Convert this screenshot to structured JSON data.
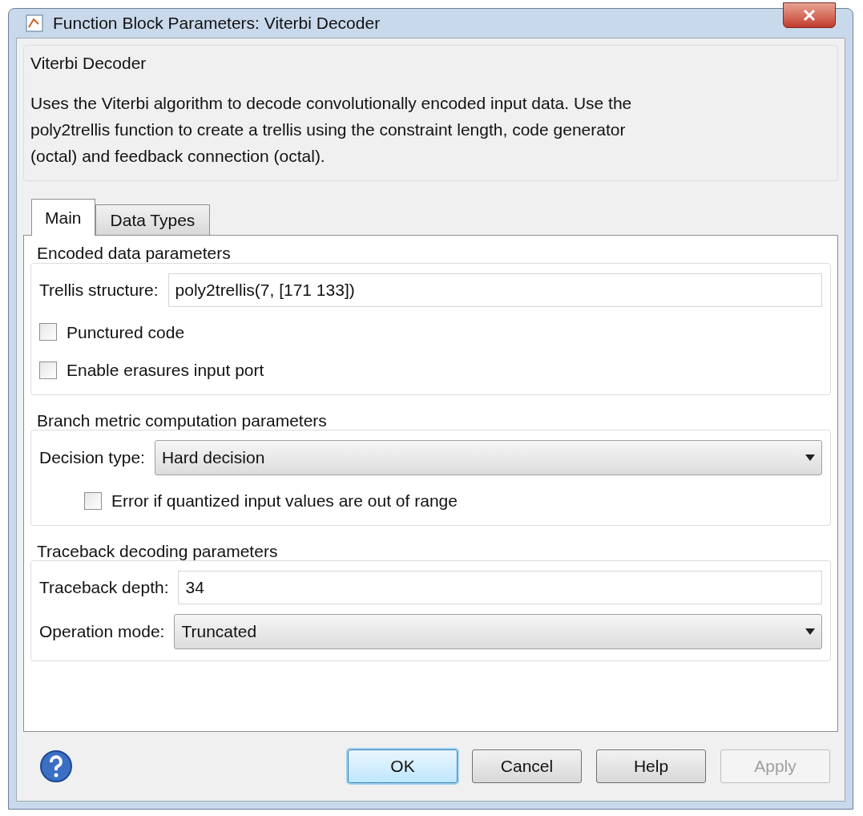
{
  "window": {
    "title": "Function Block Parameters: Viterbi Decoder"
  },
  "description": {
    "title": "Viterbi Decoder",
    "text": "Uses the Viterbi algorithm to decode convolutionally encoded input data.  Use the poly2trellis function to create a trellis using the constraint length, code generator (octal) and feedback connection (octal)."
  },
  "tabs": [
    {
      "label": "Main",
      "selected": true
    },
    {
      "label": "Data Types",
      "selected": false
    }
  ],
  "groups": [
    {
      "title": "Encoded data parameters",
      "items": [
        {
          "kind": "field",
          "label": "Trellis structure:",
          "value": "poly2trellis(7, [171 133])"
        },
        {
          "kind": "checkbox",
          "label": "Punctured code",
          "checked": false
        },
        {
          "kind": "checkbox",
          "label": "Enable erasures input port",
          "checked": false
        }
      ]
    },
    {
      "title": "Branch metric computation parameters",
      "items": [
        {
          "kind": "dropdown",
          "label": "Decision type:",
          "value": "Hard decision"
        },
        {
          "kind": "subcheckbox",
          "label": "Error if quantized input values are out of range",
          "checked": false
        }
      ]
    },
    {
      "title": "Traceback decoding parameters",
      "items": [
        {
          "kind": "field",
          "label": "Traceback depth:",
          "value": "34"
        },
        {
          "kind": "dropdown",
          "label": "Operation mode:",
          "value": "Truncated"
        }
      ]
    }
  ],
  "buttons": [
    {
      "label": "OK",
      "default": true,
      "disabled": false
    },
    {
      "label": "Cancel",
      "default": false,
      "disabled": false
    },
    {
      "label": "Help",
      "default": false,
      "disabled": false
    },
    {
      "label": "Apply",
      "default": false,
      "disabled": true
    }
  ]
}
